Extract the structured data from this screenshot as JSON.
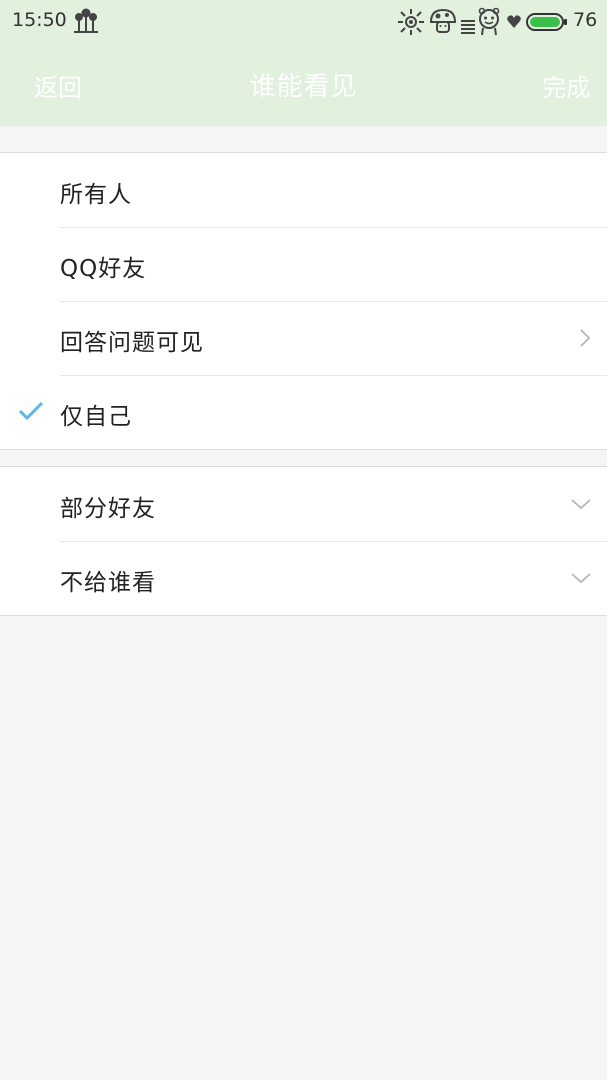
{
  "status_bar": {
    "time": "15:50",
    "battery_percent": "76",
    "icons": [
      "tree-flower-icon",
      "sun-icon",
      "mushroom-icon",
      "signal-bars-icon",
      "cartoon-icon",
      "heart-icon",
      "battery-icon"
    ]
  },
  "nav": {
    "back": "返回",
    "title": "谁能看见",
    "done": "完成"
  },
  "visibility_options": [
    {
      "label": "所有人",
      "selected": false,
      "has_arrow": false
    },
    {
      "label": "QQ好友",
      "selected": false,
      "has_arrow": false
    },
    {
      "label": "回答问题可见",
      "selected": false,
      "has_arrow": true
    },
    {
      "label": "仅自己",
      "selected": true,
      "has_arrow": false
    }
  ],
  "friend_options": [
    {
      "label": "部分好友",
      "expandable": true
    },
    {
      "label": "不给谁看",
      "expandable": true
    }
  ],
  "colors": {
    "header_bg": "#e2f0de",
    "check": "#5bb8e6",
    "page_bg": "#f5f5f5"
  }
}
